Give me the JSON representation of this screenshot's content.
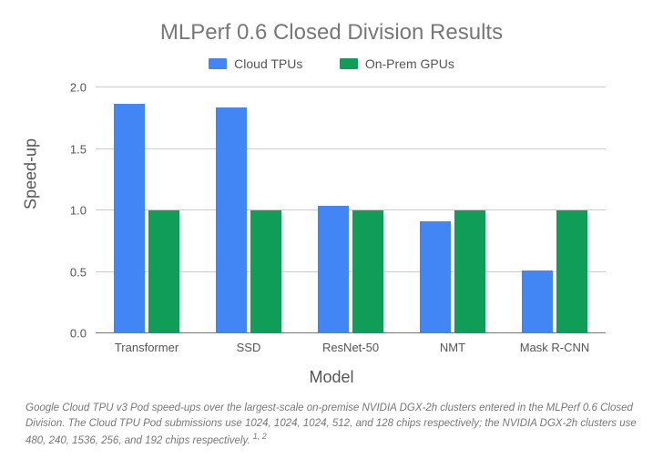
{
  "chart_data": {
    "type": "bar",
    "title": "MLPerf 0.6 Closed Division Results",
    "xlabel": "Model",
    "ylabel": "Speed-up",
    "ylim": [
      0.0,
      2.0
    ],
    "yticks": [
      0.0,
      0.5,
      1.0,
      1.5,
      2.0
    ],
    "ytick_labels": [
      "0.0",
      "0.5",
      "1.0",
      "1.5",
      "2.0"
    ],
    "categories": [
      "Transformer",
      "SSD",
      "ResNet-50",
      "NMT",
      "Mask R-CNN"
    ],
    "series": [
      {
        "name": "Cloud TPUs",
        "color": "#4285F4",
        "values": [
          1.87,
          1.84,
          1.04,
          0.91,
          0.51
        ]
      },
      {
        "name": "On-Prem GPUs",
        "color": "#0F9D58",
        "values": [
          1.0,
          1.0,
          1.0,
          1.0,
          1.0
        ]
      }
    ]
  },
  "caption": "Google Cloud TPU v3 Pod speed-ups over the largest-scale on-premise NVIDIA DGX-2h clusters entered in the MLPerf 0.6 Closed Division. The Cloud TPU Pod submissions use 1024, 1024, 1024, 512, and 128 chips respectively; the NVIDIA DGX-2h clusters use 480, 240, 1536, 256, and 192 chips respectively.",
  "caption_suffix": "1, 2"
}
